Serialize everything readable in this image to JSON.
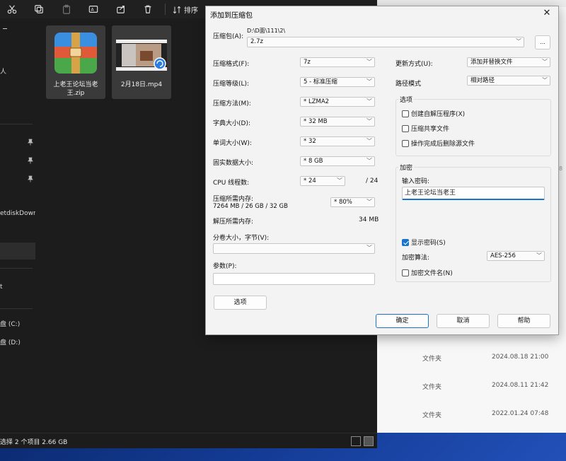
{
  "explorer": {
    "toolbar": {
      "sort_label": "排序"
    },
    "sidebar": {
      "items": [
        {
          "label": "人"
        },
        {
          "label": "etdiskDown"
        },
        {
          "label": "t"
        },
        {
          "label": "盘 (C:)"
        },
        {
          "label": "盘 (D:)"
        }
      ]
    },
    "files": [
      {
        "name": "上老王论坛当老王.zip",
        "icon": "winrar-archive-icon"
      },
      {
        "name": "2月18日.mp4",
        "icon": "video-thumbnail-icon"
      }
    ],
    "status": "选择 2 个项目  2.66 GB"
  },
  "background_window": {
    "side_text": "8",
    "rows": [
      {
        "type": "文件夹",
        "date": "2024.08.18 21:00"
      },
      {
        "type": "文件夹",
        "date": "2024.08.11 21:42"
      },
      {
        "type": "文件夹",
        "date": "2022.01.24 07:48"
      }
    ]
  },
  "dialog": {
    "title": "添加到压缩包",
    "archive_label": "压缩包(A):",
    "archive_path": "D:\\D面\\111\\2\\",
    "archive_name": "2.7z",
    "browse_label": "...",
    "format_label": "压缩格式(F):",
    "format_value": "7z",
    "level_label": "压缩等级(L):",
    "level_value": "5 - 标准压缩",
    "method_label": "压缩方法(M):",
    "method_value": "* LZMA2",
    "dict_label": "字典大小(D):",
    "dict_value": "* 32 MB",
    "word_label": "单词大小(W):",
    "word_value": "* 32",
    "solid_label": "固实数据大小:",
    "solid_value": "* 8 GB",
    "threads_label": "CPU 线程数:",
    "threads_value": "* 24",
    "threads_max": "/ 24",
    "mem_label": "压缩所需内存:",
    "mem_detail": "7264 MB / 26 GB / 32 GB",
    "mem_value": "* 80%",
    "decomp_label": "解压所需内存:",
    "decomp_value": "34 MB",
    "split_label": "分卷大小，字节(V):",
    "split_value": "",
    "params_label": "参数(P):",
    "params_value": "",
    "options_button": "选项",
    "update_label": "更新方式(U):",
    "update_value": "添加并替换文件",
    "pathmode_label": "路径模式",
    "pathmode_value": "相对路径",
    "options_group": "选项",
    "opt_sfx": "创建自解压程序(X)",
    "opt_shared": "压缩共享文件",
    "opt_delete": "操作完成后删除源文件",
    "encrypt_group": "加密",
    "enter_password_label": "输入密码:",
    "password_value": "上老王论坛当老王",
    "show_password": "显示密码(S)",
    "enc_method_label": "加密算法:",
    "enc_method_value": "AES-256",
    "encrypt_names": "加密文件名(N)",
    "ok": "确定",
    "cancel": "取消",
    "help": "帮助"
  }
}
